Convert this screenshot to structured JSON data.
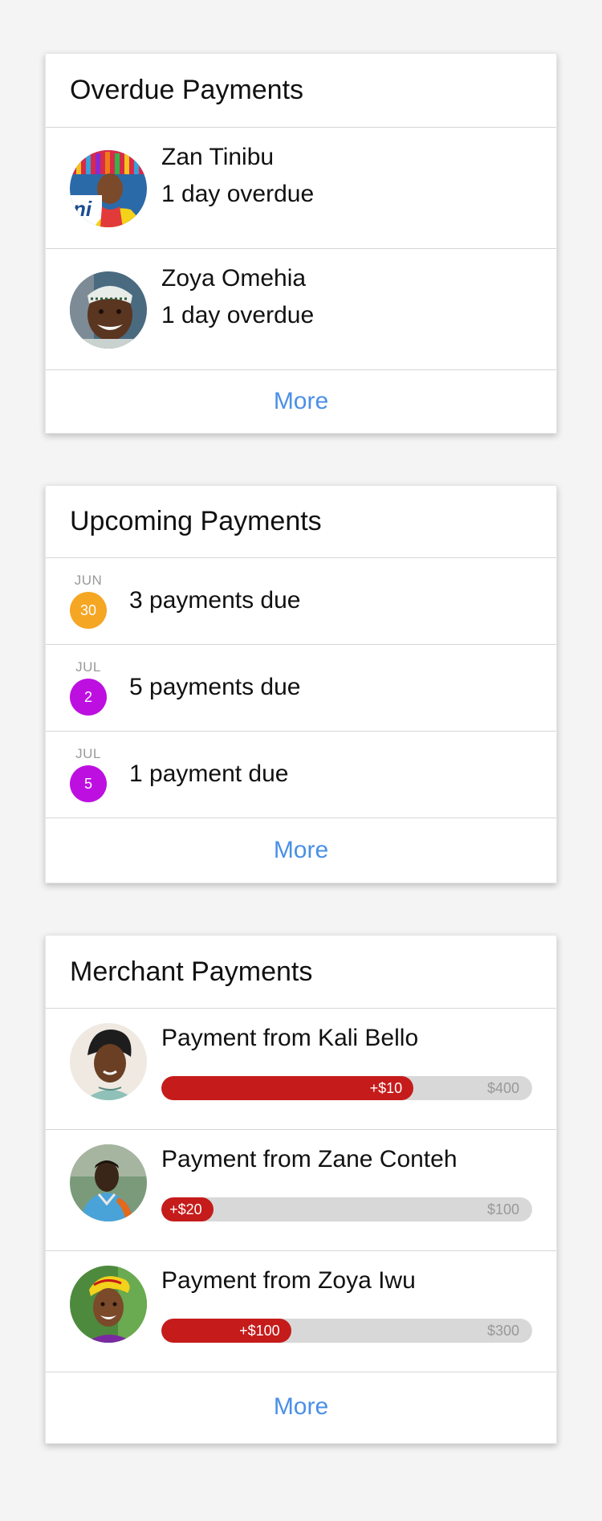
{
  "overdue": {
    "title": "Overdue Payments",
    "items": [
      {
        "name": "Zan Tinibu",
        "status": "1 day overdue",
        "avatar": "person-avatar-colorful-hat"
      },
      {
        "name": "Zoya Omehia",
        "status": "1 day overdue",
        "avatar": "person-avatar-kufi-cap"
      }
    ],
    "more_label": "More"
  },
  "upcoming": {
    "title": "Upcoming Payments",
    "items": [
      {
        "month": "JUN",
        "day": "30",
        "color": "#f5a623",
        "text": "3 payments due"
      },
      {
        "month": "JUL",
        "day": "2",
        "color": "#bd10e0",
        "text": "5 payments due"
      },
      {
        "month": "JUL",
        "day": "5",
        "color": "#bd10e0",
        "text": "1 payment due"
      }
    ],
    "more_label": "More"
  },
  "merchant": {
    "title": "Merchant Payments",
    "items": [
      {
        "title": "Payment from Kali Bello",
        "amount": "+$10",
        "total": "$400",
        "progress": 0.68,
        "avatar": "person-avatar-headwrap"
      },
      {
        "title": "Payment from Zane Conteh",
        "amount": "+$20",
        "total": "$100",
        "progress": 0.14,
        "avatar": "person-avatar-blue-shirt"
      },
      {
        "title": "Payment from Zoya Iwu",
        "amount": "+$100",
        "total": "$300",
        "progress": 0.35,
        "avatar": "person-avatar-yellow-headwrap"
      }
    ],
    "more_label": "More"
  },
  "colors": {
    "link": "#4a8fe7",
    "progress_fill": "#c61b1b",
    "progress_track": "#d8d8d8"
  }
}
